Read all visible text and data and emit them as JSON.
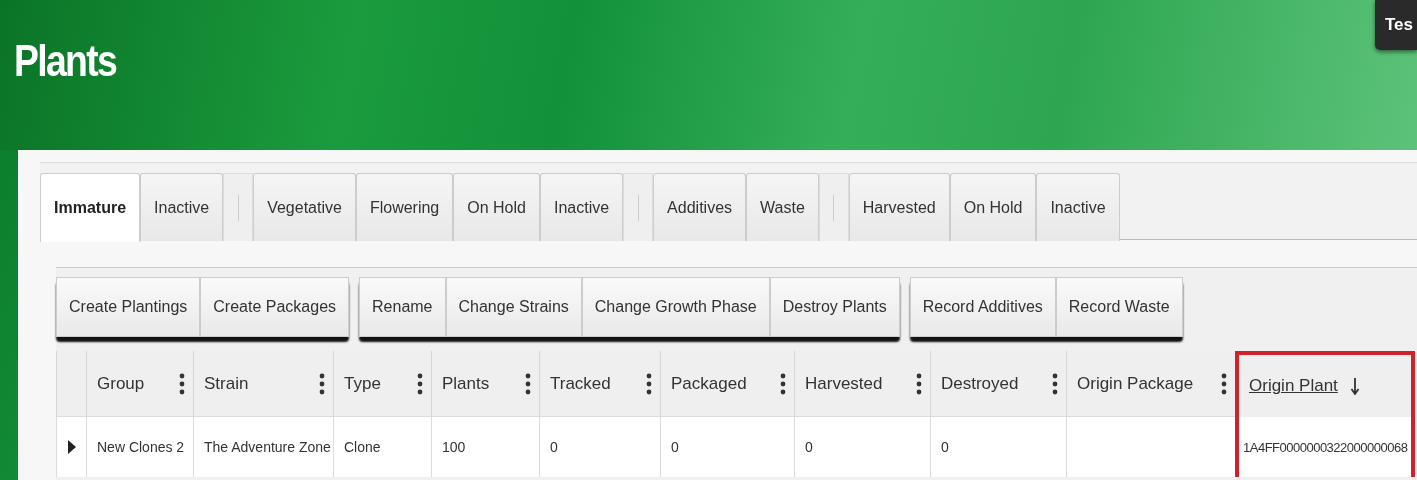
{
  "header": {
    "title": "Plants",
    "user_button": "Tes"
  },
  "tab_groups": [
    [
      {
        "label": "Immature",
        "selected": true
      },
      {
        "label": "Inactive",
        "selected": false
      }
    ],
    [
      {
        "label": "Vegetative",
        "selected": false
      },
      {
        "label": "Flowering",
        "selected": false
      },
      {
        "label": "On Hold",
        "selected": false
      },
      {
        "label": "Inactive",
        "selected": false
      }
    ],
    [
      {
        "label": "Additives",
        "selected": false
      },
      {
        "label": "Waste",
        "selected": false
      }
    ],
    [
      {
        "label": "Harvested",
        "selected": false
      },
      {
        "label": "On Hold",
        "selected": false
      },
      {
        "label": "Inactive",
        "selected": false
      }
    ]
  ],
  "button_groups": [
    [
      "Create Plantings",
      "Create Packages"
    ],
    [
      "Rename",
      "Change Strains",
      "Change Growth Phase",
      "Destroy Plants"
    ],
    [
      "Record Additives",
      "Record Waste"
    ]
  ],
  "table": {
    "columns": [
      {
        "label": "Group",
        "sorted": false,
        "highlighted": false
      },
      {
        "label": "Strain",
        "sorted": false,
        "highlighted": false
      },
      {
        "label": "Type",
        "sorted": false,
        "highlighted": false
      },
      {
        "label": "Plants",
        "sorted": false,
        "highlighted": false
      },
      {
        "label": "Tracked",
        "sorted": false,
        "highlighted": false
      },
      {
        "label": "Packaged",
        "sorted": false,
        "highlighted": false
      },
      {
        "label": "Harvested",
        "sorted": false,
        "highlighted": false
      },
      {
        "label": "Destroyed",
        "sorted": false,
        "highlighted": false
      },
      {
        "label": "Origin Package",
        "sorted": false,
        "highlighted": false
      },
      {
        "label": "Origin Plant",
        "sorted": true,
        "highlighted": true
      }
    ],
    "rows": [
      {
        "expanded": false,
        "cells": [
          "New Clones 2",
          "The Adventure Zone",
          "Clone",
          "100",
          "0",
          "0",
          "0",
          "0",
          null,
          "1A4FF0000000322000000068"
        ]
      }
    ]
  }
}
